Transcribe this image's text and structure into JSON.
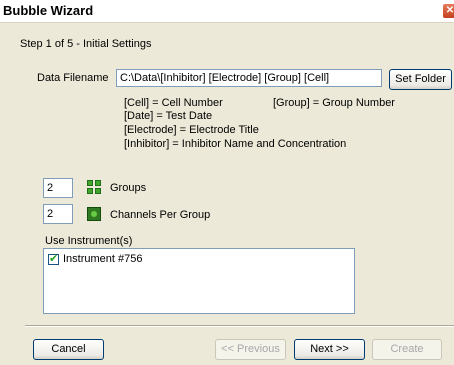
{
  "window": {
    "title": "Bubble Wizard",
    "close_symbol": "✕"
  },
  "step_text": "Step 1 of 5 - Initial Settings",
  "filename": {
    "label": "Data Filename",
    "value": "C:\\Data\\[Inhibitor] [Electrode] [Group] [Cell]",
    "set_folder_label": "Set Folder"
  },
  "legend": {
    "cell": "[Cell] = Cell Number",
    "group": "[Group] = Group Number",
    "date": "[Date] = Test Date",
    "electrode": "[Electrode] = Electrode Title",
    "inhibitor": "[Inhibitor] = Inhibitor Name and Concentration"
  },
  "groups": {
    "value": "2",
    "label": "Groups",
    "icon": "groups-grid-icon"
  },
  "channels": {
    "value": "2",
    "label": "Channels Per Group",
    "icon": "channel-icon"
  },
  "instruments": {
    "label": "Use Instrument(s)",
    "items": [
      {
        "label": "Instrument #756",
        "checked": true
      }
    ]
  },
  "buttons": {
    "cancel": "Cancel",
    "previous": "<< Previous",
    "next": "Next >>",
    "create": "Create"
  },
  "colors": {
    "icon_green": "#3fa52d",
    "disabled_text": "#a7a6aa"
  }
}
